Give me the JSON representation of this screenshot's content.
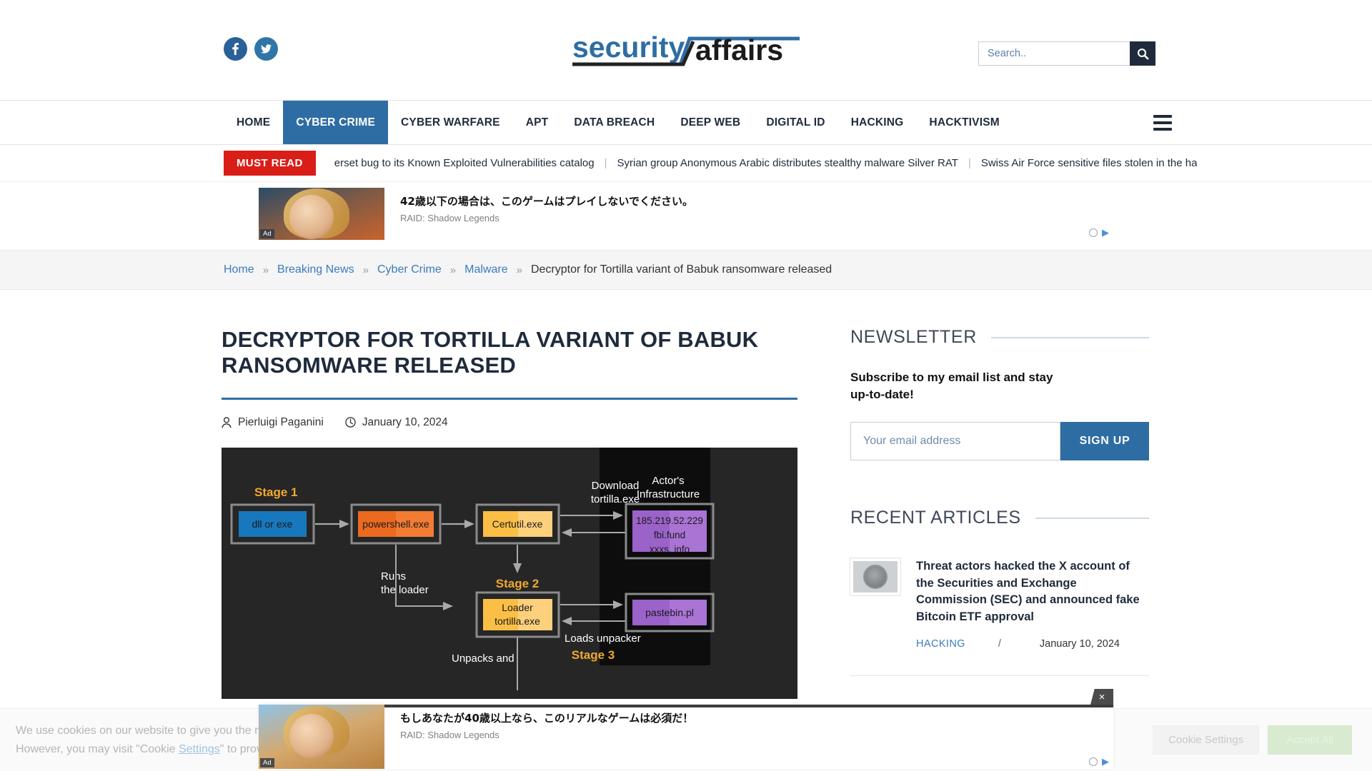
{
  "header": {
    "logo_primary": "security",
    "logo_secondary": "affairs",
    "social": [
      {
        "name": "facebook",
        "glyph": "f"
      },
      {
        "name": "twitter",
        "glyph": "✉"
      }
    ],
    "search": {
      "placeholder": "Search..",
      "value": "",
      "button_icon": "search-icon"
    }
  },
  "nav": {
    "items": [
      {
        "label": "HOME",
        "active": false
      },
      {
        "label": "CYBER CRIME",
        "active": true
      },
      {
        "label": "CYBER WARFARE",
        "active": false
      },
      {
        "label": "APT",
        "active": false
      },
      {
        "label": "DATA BREACH",
        "active": false
      },
      {
        "label": "DEEP WEB",
        "active": false
      },
      {
        "label": "DIGITAL ID",
        "active": false
      },
      {
        "label": "HACKING",
        "active": false
      },
      {
        "label": "HACKTIVISM",
        "active": false
      }
    ],
    "active_color": "#2e6da4",
    "menu_icon": "hamburger-icon"
  },
  "ticker": {
    "badge": "MUST READ",
    "badge_color": "#d91e18",
    "items": [
      "erset bug to its Known Exploited Vulnerabilities catalog",
      "Syrian group Anonymous Arabic distributes stealthy malware Silver RAT",
      "Swiss Air Force sensitive files stolen in the ha"
    ],
    "separator": "|"
  },
  "ads": {
    "top": {
      "title": "42歳以下の場合は、このゲームはプレイしないでください。",
      "advertiser": "RAID: Shadow Legends",
      "badge": "Ad"
    },
    "bottom": {
      "title": "もしあなたが40歳以上なら、このリアルなゲームは必須だ！",
      "advertiser": "RAID: Shadow Legends",
      "badge": "Ad",
      "close_label": "×"
    }
  },
  "breadcrumb": {
    "items": [
      {
        "label": "Home",
        "link": true
      },
      {
        "label": "Breaking News",
        "link": true
      },
      {
        "label": "Cyber Crime",
        "link": true
      },
      {
        "label": "Malware",
        "link": true
      },
      {
        "label": "Decryptor for Tortilla variant of Babuk ransomware released",
        "link": false
      }
    ],
    "separator": "»"
  },
  "article": {
    "title": "DECRYPTOR FOR TORTILLA VARIANT OF BABUK RANSOMWARE RELEASED",
    "author": "Pierluigi Paganini",
    "author_icon": "user-icon",
    "date": "January 10, 2024",
    "date_icon": "clock-icon",
    "figure": {
      "stages": [
        {
          "label": "Stage 1"
        },
        {
          "label": "Stage 2"
        },
        {
          "label": "Stage 3"
        }
      ],
      "nodes": [
        {
          "id": "dll_or_exe",
          "label": "dll or exe",
          "color": "#1878be"
        },
        {
          "id": "powershell",
          "label": "powershell.exe",
          "color": "#ec6a1f"
        },
        {
          "id": "certutil",
          "label": "Certutil.exe",
          "color": "#fbbf45"
        },
        {
          "id": "loader",
          "label_line1": "Loader",
          "label_line2": "tortilla.exe",
          "color": "#fbbf45"
        },
        {
          "id": "c2",
          "label_line1": "185.219.52.229",
          "label_line2": "fbi.fund",
          "label_line3": "xxxs. info",
          "color": "#9b62c9"
        },
        {
          "id": "pastebin",
          "label": "pastebin.pl",
          "color": "#9b62c9"
        }
      ],
      "group_label_line1": "Actor's",
      "group_label_line2": "Infrastructure",
      "edge_labels": [
        {
          "line1": "Download",
          "line2": "tortilla.exe"
        },
        {
          "line1": "Runs",
          "line2": "the loader"
        },
        {
          "line1": "Loads unpacker"
        },
        {
          "line1": "Unpacks and"
        }
      ]
    }
  },
  "sidebar": {
    "newsletter": {
      "heading": "NEWSLETTER",
      "description": "Subscribe to my email list and stay up-to-date!",
      "email_placeholder": "Your email address",
      "email_value": "",
      "signup_label": "SIGN UP"
    },
    "recent": {
      "heading": "RECENT ARTICLES",
      "items": [
        {
          "title": "Threat actors hacked the X account of the Securities and Exchange Commission (SEC) and announced fake Bitcoin ETF approval",
          "category": "HACKING",
          "separator": "/",
          "date": "January 10, 2024"
        }
      ]
    }
  },
  "cookie_banner": {
    "text_line1": "We use cookies on our website to give you the most relevant expe",
    "text_line2_a": "However, you may visit \"Cookie ",
    "settings_link": "Settings",
    "text_line2_b": "\" to provide a controlled c",
    "settings_button": "Cookie Settings",
    "accept_button": "Accept All"
  }
}
